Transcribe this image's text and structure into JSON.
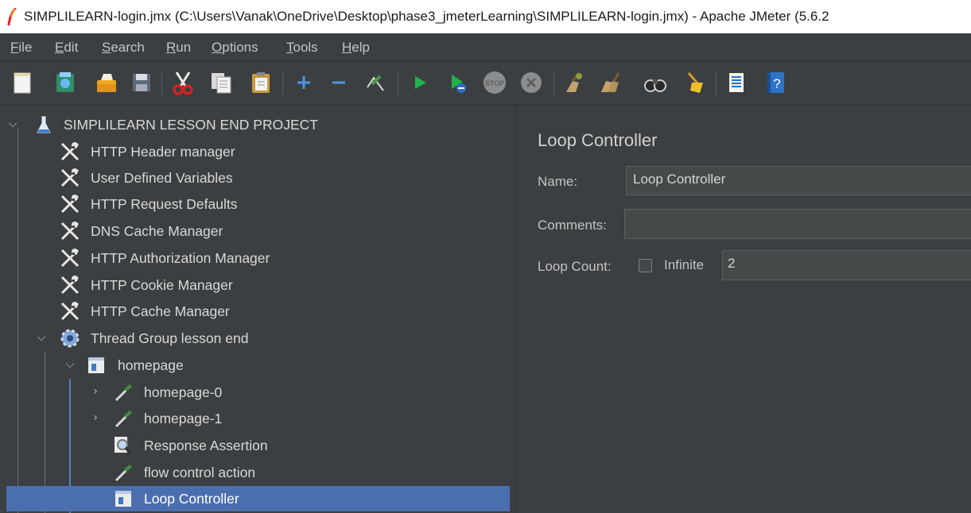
{
  "window": {
    "title": "SIMPLILEARN-login.jmx (C:\\Users\\Vanak\\OneDrive\\Desktop\\phase3_jmeterLearning\\SIMPLILEARN-login.jmx) - Apache JMeter (5.6.2"
  },
  "menu": [
    {
      "mnemonic": "F",
      "rest": "ile"
    },
    {
      "mnemonic": "E",
      "rest": "dit"
    },
    {
      "mnemonic": "S",
      "rest": "earch"
    },
    {
      "mnemonic": "R",
      "rest": "un"
    },
    {
      "mnemonic": "O",
      "rest": "ptions"
    },
    {
      "mnemonic": "T",
      "rest": "ools"
    },
    {
      "mnemonic": "H",
      "rest": "elp"
    }
  ],
  "toolbar_icons": [
    "new-icon",
    "templates-icon",
    "open-icon",
    "save-icon",
    "cut-icon",
    "copy-icon",
    "paste-icon",
    "expand-icon",
    "collapse-icon",
    "toggle-icon",
    "start-icon",
    "start-no-pauses-icon",
    "stop-icon",
    "shutdown-icon",
    "clear-icon",
    "clear-all-icon",
    "search-icon",
    "reset-search-icon",
    "function-helper-icon",
    "help-icon"
  ],
  "tree": {
    "root": "SIMPLILEARN LESSON END PROJECT",
    "config_items": [
      "HTTP Header manager",
      "User Defined Variables",
      "HTTP Request Defaults",
      "DNS Cache Manager",
      "HTTP Authorization Manager",
      "HTTP Cookie Manager",
      "HTTP Cache Manager"
    ],
    "thread_group": "Thread Group lesson end",
    "controller": "homepage",
    "samplers": [
      "homepage-0",
      "homepage-1"
    ],
    "assertion": "Response Assertion",
    "flow_action": "flow control action",
    "selected": "Loop Controller"
  },
  "panel": {
    "title": "Loop Controller",
    "name_label": "Name:",
    "name_value": "Loop Controller",
    "comments_label": "Comments:",
    "comments_value": "",
    "loop_count_label": "Loop Count:",
    "infinite_label": "Infinite",
    "infinite_checked": false,
    "loop_count_value": "2"
  },
  "colors": {
    "background": "#3c3f41",
    "selection": "#4b6eaf",
    "tree_guide_active": "#4a88c7"
  }
}
